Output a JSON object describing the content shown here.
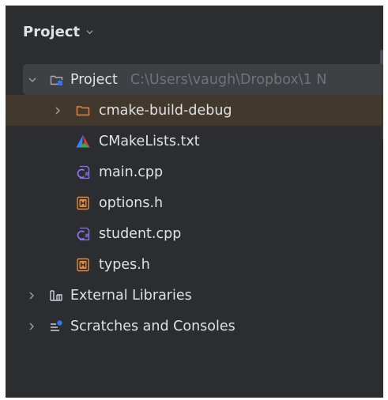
{
  "header": {
    "title": "Project"
  },
  "tree": {
    "root": {
      "label": "Project",
      "path": "C:\\Users\\vaugh\\Dropbox\\1 N"
    },
    "folder": {
      "label": "cmake-build-debug"
    },
    "files": [
      {
        "label": "CMakeLists.txt",
        "icon": "cmake-icon"
      },
      {
        "label": "main.cpp",
        "icon": "cpp-file-icon"
      },
      {
        "label": "options.h",
        "icon": "header-file-icon"
      },
      {
        "label": "student.cpp",
        "icon": "cpp-file-icon"
      },
      {
        "label": "types.h",
        "icon": "header-file-icon"
      }
    ],
    "external_libraries": "External Libraries",
    "scratches": "Scratches and Consoles"
  },
  "colors": {
    "panel_bg": "#2b2d30",
    "root_row_bg": "#3e4043",
    "selected_row_bg": "#43382c",
    "text": "#dfe1e5",
    "path_text": "#6f737a",
    "cpp_icon": "#8c72ee",
    "header_icon": "#e58a3c"
  }
}
